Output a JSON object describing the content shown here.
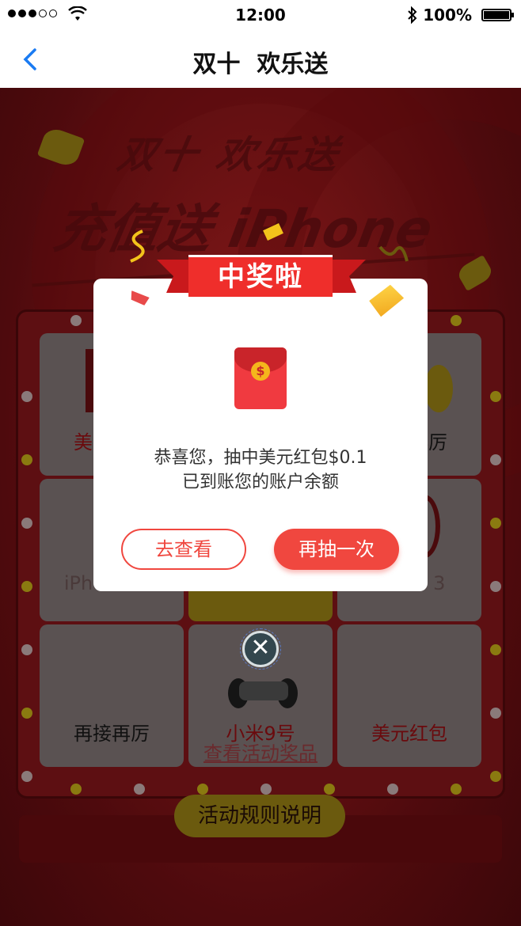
{
  "status_bar": {
    "time": "12:00",
    "battery": "100%"
  },
  "nav": {
    "title": "双十  欢乐送"
  },
  "hero": {
    "line1": "双十 欢乐送",
    "line2": "充值送 iPhone"
  },
  "board": {
    "cells": [
      {
        "label": "美元红包"
      },
      {
        "label": ""
      },
      {
        "label": "再接再厉"
      },
      {
        "label": "iPhone XS"
      },
      {
        "label": ""
      },
      {
        "label": "Beats 3"
      },
      {
        "label": "再接再厉"
      },
      {
        "label": "小米9号"
      },
      {
        "label": "美元红包"
      }
    ]
  },
  "modal": {
    "banner": "中奖啦",
    "coin_symbol": "$",
    "message_line1": "恭喜您，抽中美元红包$0.1",
    "message_line2": "已到账您的账户余额",
    "view_button": "去查看",
    "again_button": "再抽一次"
  },
  "close_icon": "✕",
  "links": {
    "prizes": "查看活动奖品",
    "rules": "活动规则说明"
  },
  "colors": {
    "accent": "#f0473f",
    "banner": "#ef2e2b",
    "background": "#4e0a0d"
  }
}
